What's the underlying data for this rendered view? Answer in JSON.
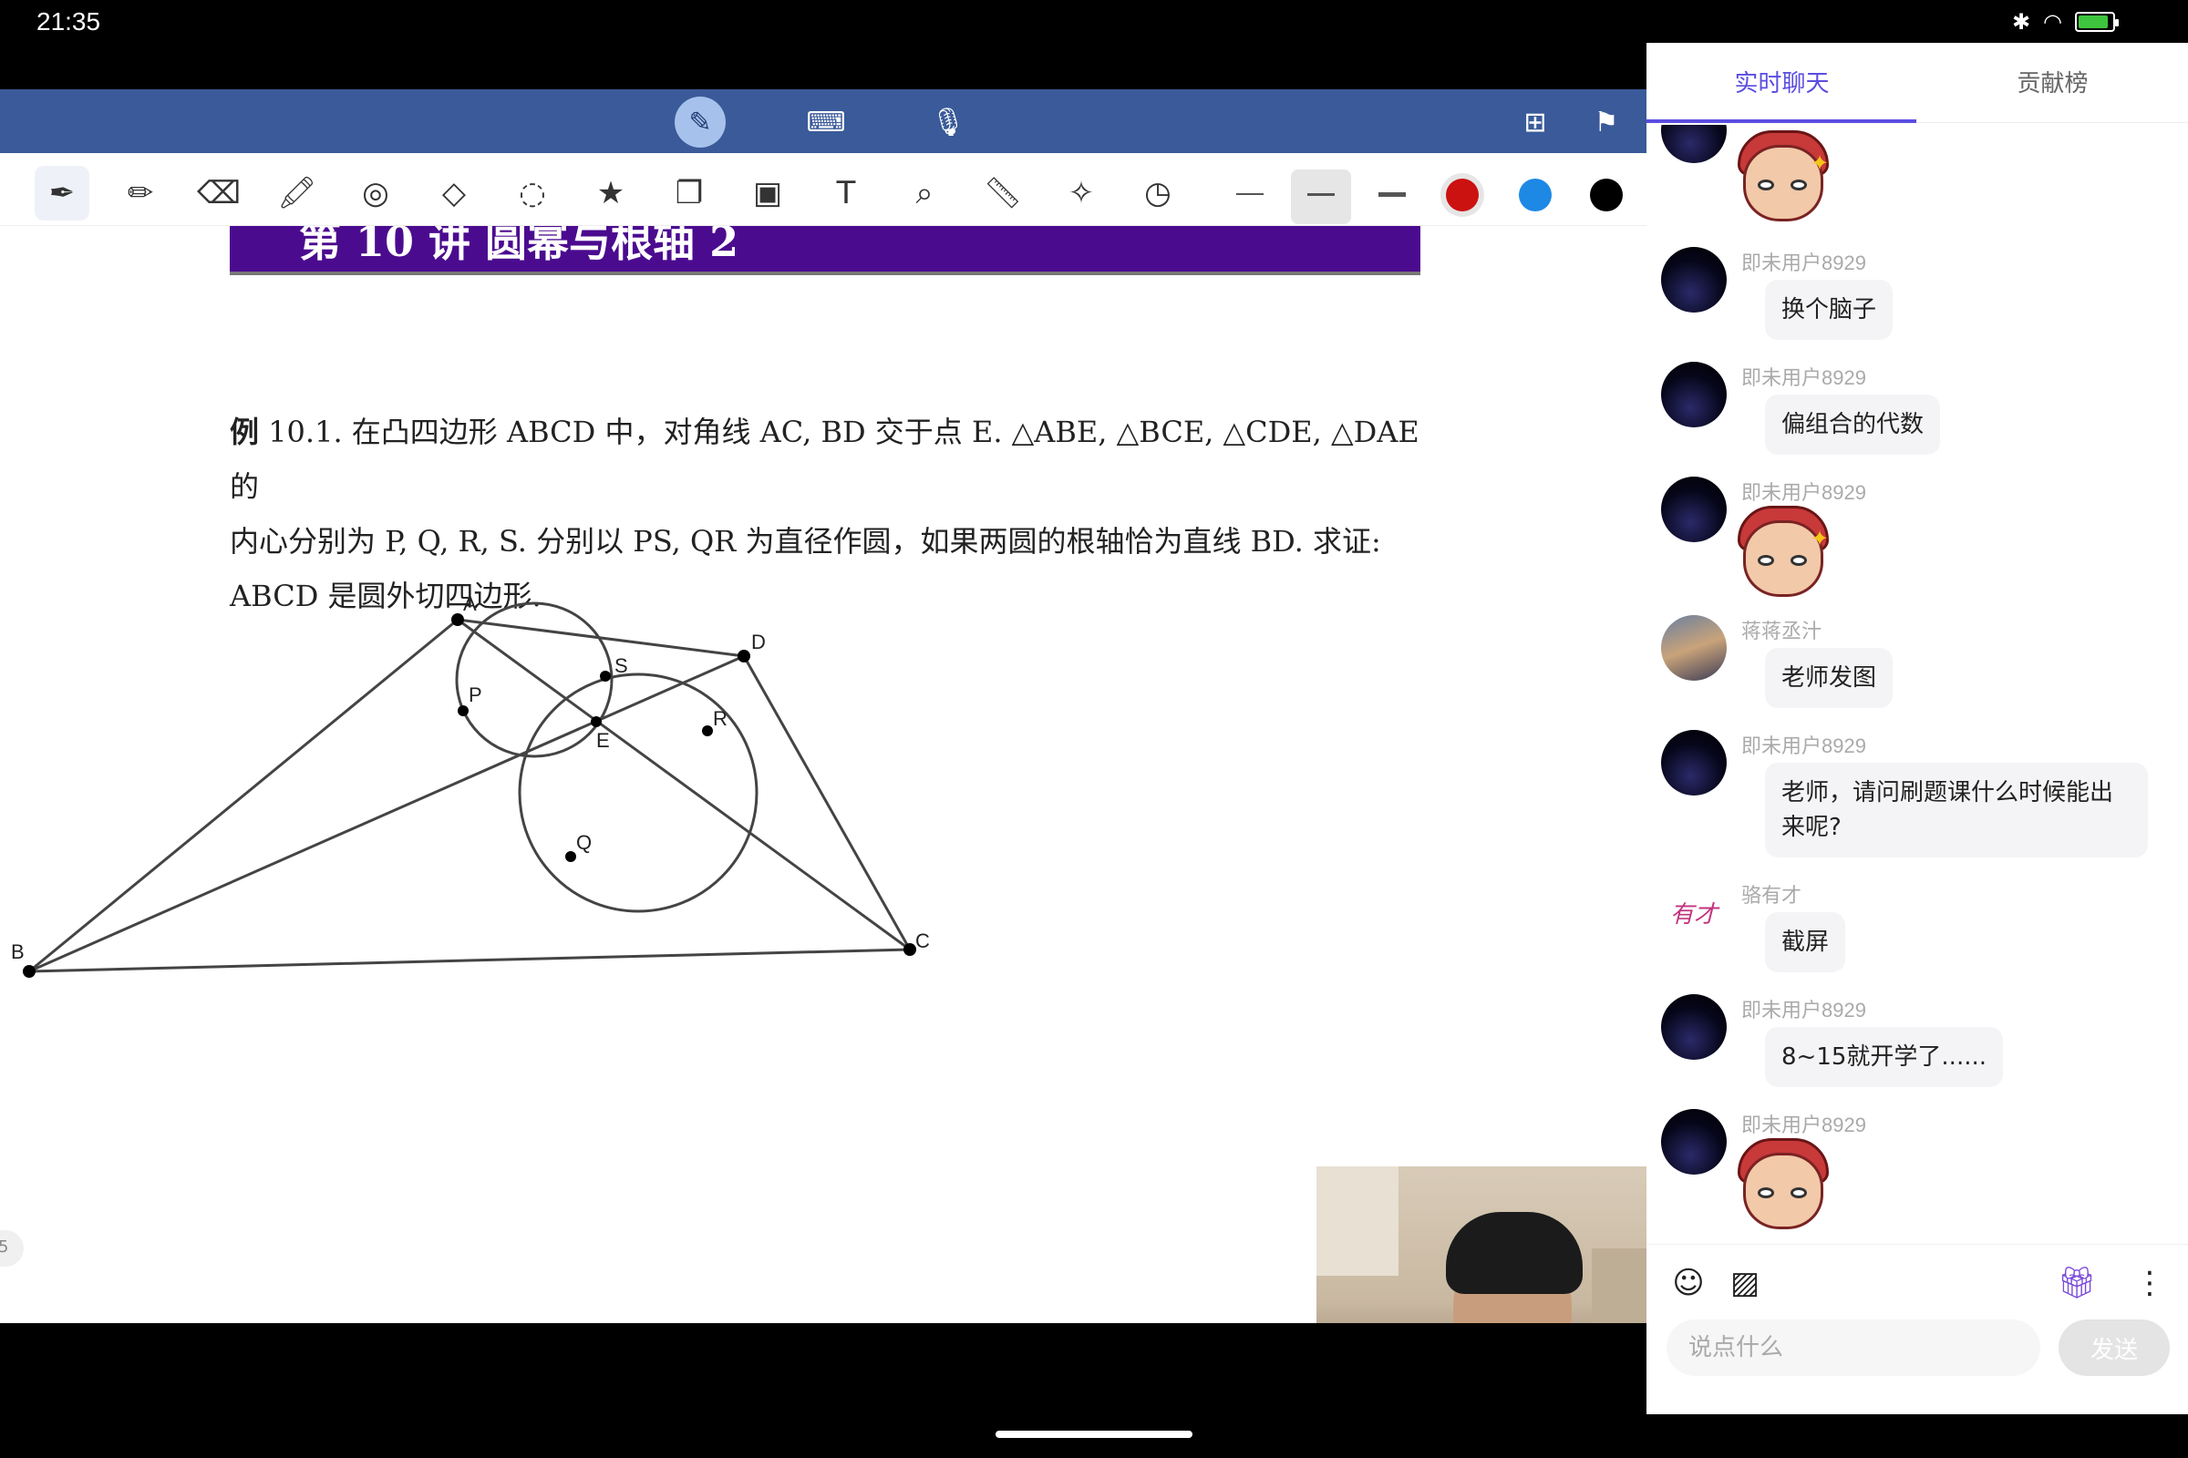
{
  "status": {
    "time": "21:35",
    "battery_level": "69"
  },
  "toolbar": {
    "top_icons": [
      "pen-icon",
      "keyboard-icon",
      "microphone-icon",
      "add-page-icon",
      "bookmark-icon"
    ],
    "tools": [
      "smart-pen-icon",
      "pencil-icon",
      "eraser-icon",
      "highlighter-icon",
      "spiral-icon",
      "shapes-icon",
      "lasso-icon",
      "sticker-icon",
      "copy-icon",
      "image-icon",
      "text-icon",
      "image-search-icon",
      "ruler-icon",
      "laser-pointer-icon",
      "clock-icon"
    ],
    "colors": [
      "#cc1111",
      "#1e88e5",
      "#000000"
    ]
  },
  "doc": {
    "title": "第 10 讲    圆幂与根轴 2",
    "problem_label": "例",
    "problem_number": "10.1.",
    "problem_line1": "在凸四边形 ABCD 中，对角线 AC, BD 交于点 E. △ABE, △BCE, △CDE, △DAE 的",
    "problem_line2": "内心分别为 P, Q, R, S. 分别以 PS, QR 为直径作圆，如果两圆的根轴恰为直线 BD. 求证:",
    "problem_line3": "ABCD 是圆外切四边形.",
    "points": {
      "A": "A",
      "B": "B",
      "C": "C",
      "D": "D",
      "E": "E",
      "P": "P",
      "Q": "Q",
      "R": "R",
      "S": "S"
    },
    "page_tab_partial": "5"
  },
  "chat": {
    "tab_live": "实时聊天",
    "tab_rank": "贡献榜",
    "messages": [
      {
        "user": "",
        "type": "sticker"
      },
      {
        "user": "即未用户8929",
        "text": "换个脑子"
      },
      {
        "user": "即未用户8929",
        "text": "偏组合的代数"
      },
      {
        "user": "即未用户8929",
        "type": "sticker"
      },
      {
        "user": "蒋蒋丞汁",
        "text": "老师发图"
      },
      {
        "user": "即未用户8929",
        "text": "老师，请问刷题课什么时候能出来呢?"
      },
      {
        "user": "骆有才",
        "avatar_text": "有才",
        "text": "截屏"
      },
      {
        "user": "即未用户8929",
        "text": "8~15就开学了......"
      },
      {
        "user": "即未用户8929",
        "type": "sticker"
      }
    ],
    "input_placeholder": "说点什么",
    "send_label": "发送"
  }
}
